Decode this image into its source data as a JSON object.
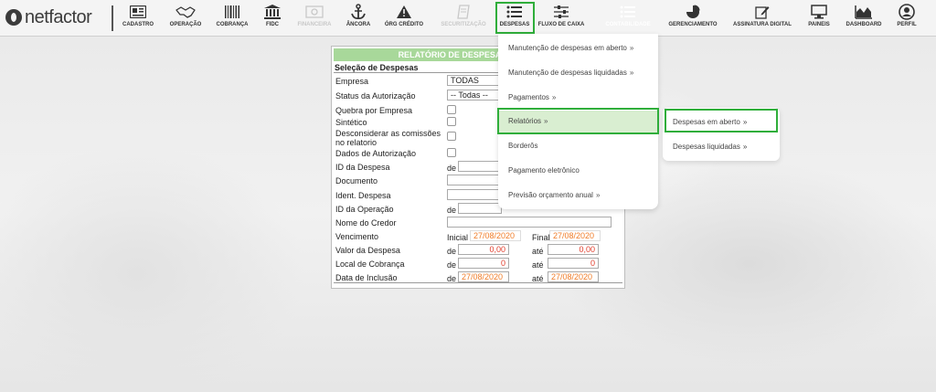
{
  "brand": {
    "o": "O",
    "name": "netfactor"
  },
  "nav": [
    {
      "label": "CADASTRO",
      "icon": "id-card-icon"
    },
    {
      "label": "OPERAÇÃO",
      "icon": "handshake-icon"
    },
    {
      "label": "COBRANÇA",
      "icon": "barcode-icon"
    },
    {
      "label": "FIDC",
      "icon": "bank-icon"
    },
    {
      "label": "FINANCEIRA",
      "icon": "money-icon"
    },
    {
      "label": "ÂNCORA",
      "icon": "anchor-icon"
    },
    {
      "label": "ÓRG CRÉDITO",
      "icon": "warning-icon"
    },
    {
      "label": "SECURITIZAÇÃO",
      "icon": "document-icon"
    },
    {
      "label": "DESPESAS",
      "icon": "list-icon"
    },
    {
      "label": "FLUXO DE CAIXA",
      "icon": "sliders-icon"
    },
    {
      "label": "CONTABILIDADE",
      "icon": "list-icon"
    },
    {
      "label": "GERENCIAMENTO",
      "icon": "pie-chart-icon"
    },
    {
      "label": "ASSINATURA DIGITAL",
      "icon": "edit-icon"
    },
    {
      "label": "PAINEIS",
      "icon": "monitor-icon"
    },
    {
      "label": "DASHBOARD",
      "icon": "area-chart-icon"
    },
    {
      "label": "PERFIL",
      "icon": "user-icon"
    }
  ],
  "panel": {
    "title": "RELATÓRIO DE DESPESAS EM ABERTO",
    "section": "Seleção de Despesas",
    "labels": {
      "empresa": "Empresa",
      "status": "Status da Autorização",
      "quebra": "Quebra por Empresa",
      "sintetico": "Sintético",
      "desconsiderar1": "Desconsiderar as comissões",
      "desconsiderar2": "no relatorio",
      "dados": "Dados de Autorização",
      "id_despesa": "ID da Despesa",
      "documento": "Documento",
      "ident": "Ident. Despesa",
      "id_operacao": "ID da Operação",
      "credor": "Nome do Credor",
      "vencimento": "Vencimento",
      "valor": "Valor da Despesa",
      "local": "Local de Cobrança",
      "inclusao": "Data de Inclusão"
    },
    "values": {
      "empresa": "TODAS",
      "status": "-- Todas --",
      "venc_inicial": "27/08/2020",
      "venc_final": "27/08/2020",
      "valor_de": "0,00",
      "valor_ate": "0,00",
      "local_de": "0",
      "local_ate": "0",
      "inclusao_de": "27/08/2020",
      "inclusao_ate": "27/08/2020"
    },
    "words": {
      "de": "de",
      "ate": "até",
      "inicial": "Inicial",
      "final": "Final"
    }
  },
  "menu": {
    "items": [
      "Manutenção de despesas em aberto",
      "Manutenção de despesas liquidadas",
      "Pagamentos",
      "Relatórios",
      "Borderôs",
      "Pagamento eletrônico",
      "Previsão orçamento anual"
    ],
    "arrow": "»",
    "submenu": [
      "Despesas em aberto",
      "Despesas liquidadas"
    ]
  },
  "colors": {
    "accent": "#2fae3a",
    "title_bar": "#a8d89a",
    "highlight": "#d9eed1"
  }
}
